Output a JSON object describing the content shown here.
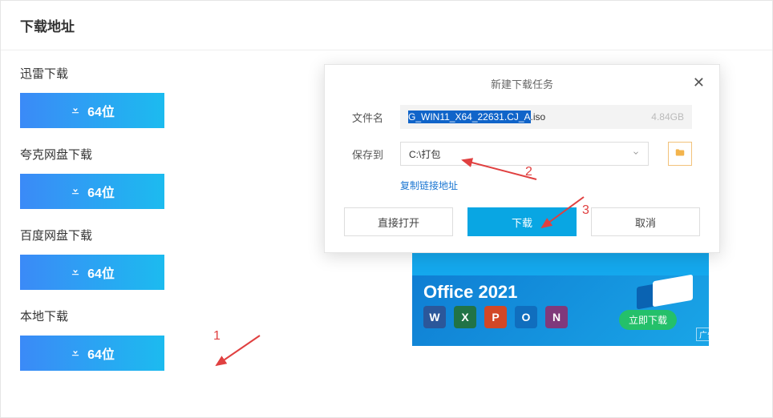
{
  "page": {
    "title": "下载地址"
  },
  "sections": [
    {
      "title": "迅雷下载",
      "button": "64位"
    },
    {
      "title": "夸克网盘下载",
      "button": "64位"
    },
    {
      "title": "百度网盘下载",
      "button": "64位"
    },
    {
      "title": "本地下载",
      "button": "64位"
    }
  ],
  "modal": {
    "title": "新建下载任务",
    "filename_label": "文件名",
    "filename_selected": "G_WIN11_X64_22631.CJ_A",
    "filename_ext": ".iso",
    "filesize": "4.84GB",
    "saveto_label": "保存到",
    "saveto_value": "C:\\打包",
    "copy_link": "复制链接地址",
    "open_direct": "直接打开",
    "download": "下载",
    "cancel": "取消"
  },
  "ad": {
    "title": "Office 2021",
    "cta": "立即下载",
    "tag": "广告",
    "icons": [
      "W",
      "X",
      "P",
      "O",
      "N"
    ]
  },
  "annotations": {
    "1": "1",
    "2": "2",
    "3": "3"
  }
}
